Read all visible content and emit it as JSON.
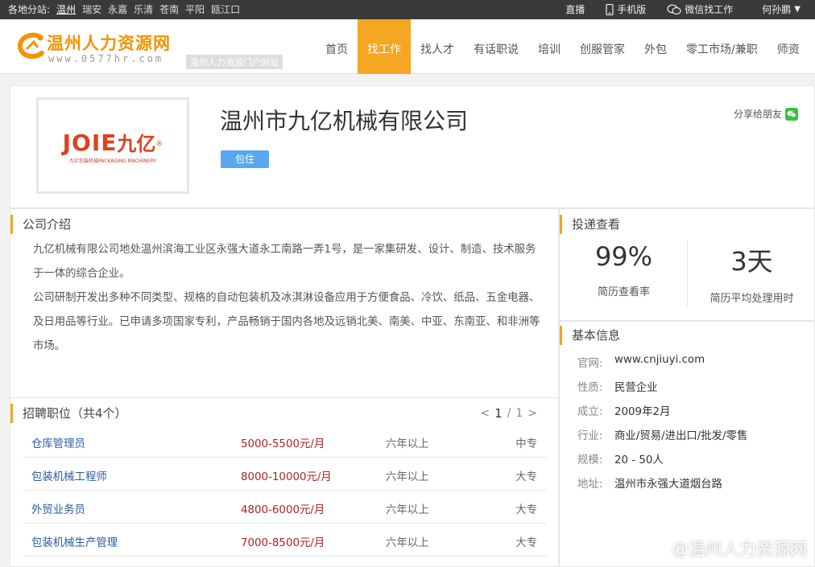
{
  "topbar": {
    "branches_label": "各地分站:",
    "cities": [
      "温州",
      "瑞安",
      "永嘉",
      "乐清",
      "苍南",
      "平阳",
      "瓯江口"
    ],
    "live": "直播",
    "mobile": "手机版",
    "wechat_jobs": "微信找工作",
    "user": "何孙鹏"
  },
  "header": {
    "site_name": "温州人力资源网",
    "site_url": "www.0577hr.com",
    "tagline": "温州人力资源门户网站",
    "nav": [
      "首页",
      "找工作",
      "找人才",
      "有话职说",
      "培训",
      "创服管家",
      "外包",
      "零工市场/兼职",
      "师资"
    ]
  },
  "company": {
    "name": "温州市九亿机械有限公司",
    "logo_text_latin": "JOIE",
    "logo_text_cn": "九亿",
    "logo_sub": "九亿包装机械PACKAGING MACHINERY",
    "badge": "包住",
    "share": "分享给朋友"
  },
  "intro": {
    "title": "公司介绍",
    "paragraphs": [
      "九亿机械有限公司地处温州滨海工业区永强大道永工南路一弄1号，是一家集研发、设计、制造、技术服务于一体的综合企业。",
      "公司研制开发出多种不同类型、规格的自动包装机及冰淇淋设备应用于方便食品、冷饮、纸品、五金电器、及日用品等行业。已申请多项国家专利，产品畅销于国内各地及远销北美、南美、中亚、东南亚、和非洲等市场。"
    ]
  },
  "jobs": {
    "title": "招聘职位（共4个）",
    "page_prev": "<",
    "page_current": "1",
    "page_sep": "/",
    "page_total": "1",
    "page_next": ">",
    "rows": [
      {
        "name": "仓库管理员",
        "salary": "5000-5500元/月",
        "exp": "六年以上",
        "edu": "中专"
      },
      {
        "name": "包装机械工程师",
        "salary": "8000-10000元/月",
        "exp": "六年以上",
        "edu": "大专"
      },
      {
        "name": "外贸业务员",
        "salary": "4800-6000元/月",
        "exp": "六年以上",
        "edu": "大专"
      },
      {
        "name": "包装机械生产管理",
        "salary": "7000-8500元/月",
        "exp": "六年以上",
        "edu": "大专"
      }
    ]
  },
  "stats": {
    "title": "投递查看",
    "view_rate": "99%",
    "view_rate_label": "简历查看率",
    "avg_time": "3天",
    "avg_time_label": "简历平均处理用时"
  },
  "info": {
    "title": "基本信息",
    "rows": [
      {
        "k": "官网:",
        "v": "www.cnjiuyi.com"
      },
      {
        "k": "性质:",
        "v": "民营企业"
      },
      {
        "k": "成立:",
        "v": "2009年2月"
      },
      {
        "k": "行业:",
        "v": "商业/贸易/进出口/批发/零售"
      },
      {
        "k": "规模:",
        "v": "20 - 50人"
      },
      {
        "k": "地址:",
        "v": "温州市永强大道烟台路"
      }
    ]
  },
  "watermark": "@温州人力资源网",
  "colors": {
    "accent": "#f5a623",
    "badge": "#57a8f0",
    "salary": "#b22222",
    "job_link": "#2b5aa5",
    "logo_red": "#e0401f"
  }
}
